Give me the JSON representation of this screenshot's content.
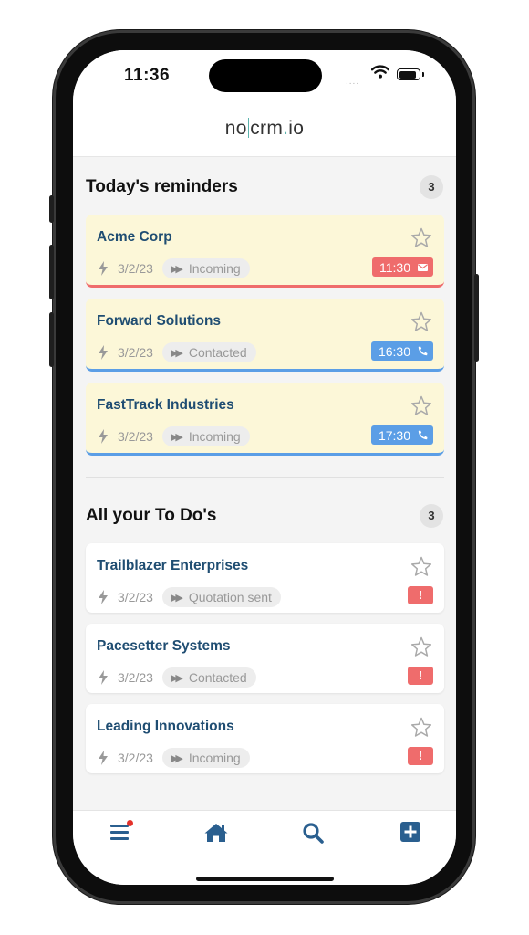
{
  "status_bar": {
    "time": "11:36",
    "signal": "...."
  },
  "header": {
    "logo_left": "no",
    "logo_mid": "crm",
    "logo_dot": ".",
    "logo_right": "io"
  },
  "reminders": {
    "title": "Today's reminders",
    "count": "3",
    "items": [
      {
        "company": "Acme Corp",
        "date": "3/2/23",
        "status": "Incoming",
        "time": "11:30",
        "icon": "mail-icon",
        "color": "#ef6c6c"
      },
      {
        "company": "Forward Solutions",
        "date": "3/2/23",
        "status": "Contacted",
        "time": "16:30",
        "icon": "phone-icon",
        "color": "#5b9ee6"
      },
      {
        "company": "FastTrack Industries",
        "date": "3/2/23",
        "status": "Incoming",
        "time": "17:30",
        "icon": "phone-icon",
        "color": "#5b9ee6"
      }
    ]
  },
  "todos": {
    "title": "All your To Do's",
    "count": "3",
    "items": [
      {
        "company": "Trailblazer Enterprises",
        "date": "3/2/23",
        "status": "Quotation sent",
        "alert": "!"
      },
      {
        "company": "Pacesetter Systems",
        "date": "3/2/23",
        "status": "Contacted",
        "alert": "!"
      },
      {
        "company": "Leading Innovations",
        "date": "3/2/23",
        "status": "Incoming",
        "alert": "!"
      }
    ]
  },
  "tabbar": {
    "items": [
      {
        "icon": "menu-icon"
      },
      {
        "icon": "home-icon"
      },
      {
        "icon": "search-icon"
      },
      {
        "icon": "add-icon"
      }
    ],
    "color": "#2a5f8f"
  },
  "colors": {
    "title_blue": "#1f4d72",
    "reminder_bg": "#fcf7d8",
    "red": "#ef6c6c",
    "blue": "#5b9ee6"
  }
}
